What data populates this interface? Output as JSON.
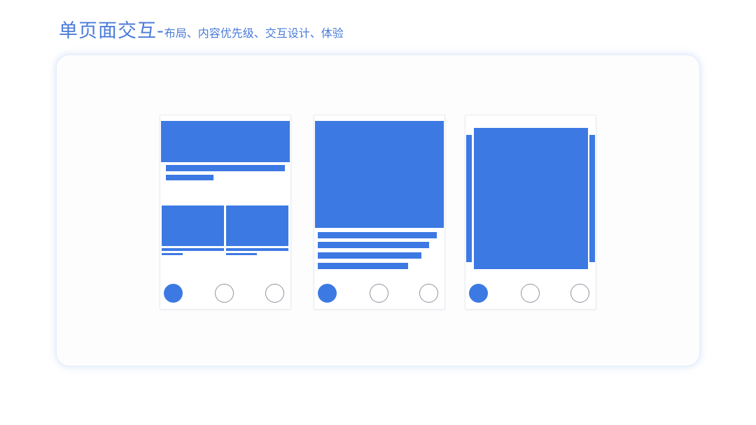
{
  "header": {
    "title_main": "单页面交互-",
    "title_sub": "布局、内容优先级、交互设计、体验"
  },
  "colors": {
    "accent": "#3d79e3",
    "title": "#4a7bd8",
    "outline": "#8f959e"
  },
  "mockups": [
    {
      "name": "list-layout",
      "nav": [
        "active-tab-icon",
        "tab-icon",
        "tab-icon"
      ]
    },
    {
      "name": "feature-layout",
      "nav": [
        "active-tab-icon",
        "tab-icon",
        "tab-icon"
      ]
    },
    {
      "name": "card-carousel-layout",
      "nav": [
        "active-tab-icon",
        "tab-icon",
        "tab-icon"
      ]
    }
  ]
}
